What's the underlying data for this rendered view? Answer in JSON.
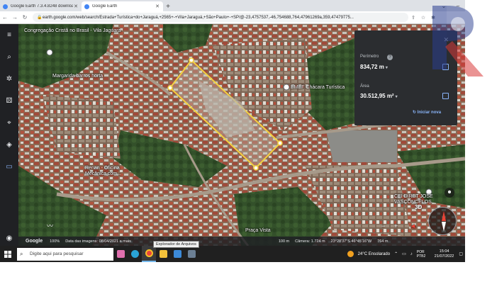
{
  "browser": {
    "tabs": [
      {
        "title": "Google Earth 7.3.4.8248 downloa",
        "active": false
      },
      {
        "title": "Google Earth",
        "active": true
      }
    ],
    "url": "earth.google.com/web/search/Estrada+Turística+do+Jaraguá,+2565+-+Vila+Jaraguá,+São+Paulo+-+SP/@-23,4757537,-46,754688,764,47961269a,359,47479775..."
  },
  "map_labels": {
    "congregacao": "Congregação Cristã no Brasil - Vila Jaguara",
    "margarida": "Margarida barros horta",
    "emef": "EMEF Chácara Turística",
    "renan": "Renan - Oficina Mecânica com...",
    "praca": "Praça Vista",
    "cei": "CEI DIRET JOSE VASCONCELOS"
  },
  "measure": {
    "perimeter_label": "Perímetro",
    "perimeter_value": "834,72 m",
    "area_label": "Área",
    "area_value": "30.512,95 m²",
    "reset_label": "Iniciar nova",
    "help_glyph": "?"
  },
  "ge_status": {
    "logo": "Google",
    "zoom": "100%",
    "imagery_date": "Data das imagens: 08/04/2021 a mais",
    "scale": "100 m",
    "camera": "Câmera: 1.724 m",
    "coords": "23°28'37\"S 46°45'16\"W",
    "elevation": "764 m"
  },
  "controls": {
    "mode_3d": "3D",
    "zoom_out": "−",
    "zoom_in": "+"
  },
  "tooltip": "Explorador de Arquivos",
  "taskbar": {
    "search_placeholder": "Digite aqui para pesquisar",
    "weather": "24°C  Ensolarado",
    "lang": "POR PTB2",
    "time": "15:04",
    "date": "21/07/2022"
  },
  "colors": {
    "polygon": "#f4d03f",
    "accent": "#8ab4f8"
  }
}
